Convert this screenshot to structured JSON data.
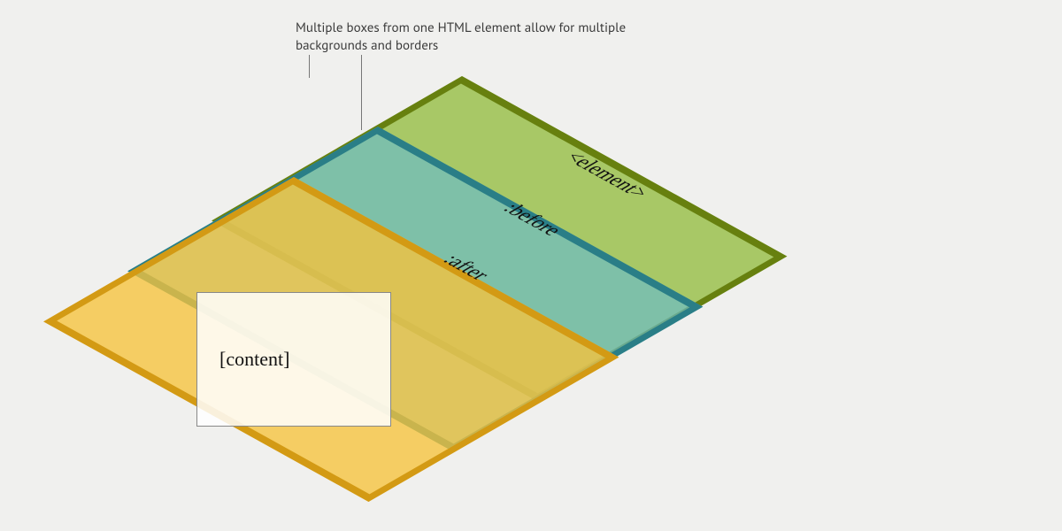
{
  "caption": "Multiple boxes from one HTML element allow for multiple backgrounds and  borders",
  "layers": {
    "element": {
      "label": "<element>",
      "fill": "rgba(148,188,64,0.78)",
      "border": "#67800f"
    },
    "before": {
      "label": ":before",
      "fill": "rgba(108,188,196,0.70)",
      "border": "#2a7e87"
    },
    "after": {
      "label": ":after",
      "fill": "rgba(246,195,60,0.78)",
      "border": "#d39a14"
    }
  },
  "content_card": {
    "label": "[content]"
  }
}
